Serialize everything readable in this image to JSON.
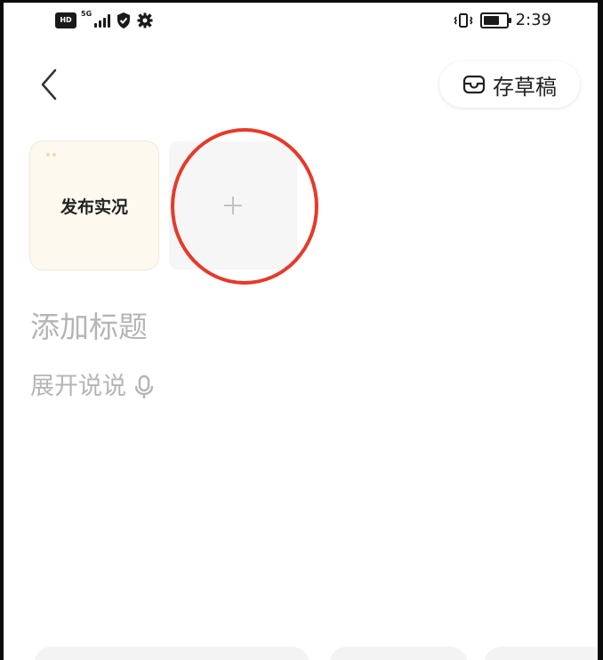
{
  "status_bar": {
    "hd": "HD",
    "network": "5G",
    "time": "2:39"
  },
  "header": {
    "back_icon": "chevron-left-icon",
    "draft_icon": "inbox-tray-icon",
    "draft_label": "存草稿"
  },
  "media": {
    "live_label": "发布实况",
    "add_icon": "plus-icon"
  },
  "editor": {
    "title_placeholder": "添加标题",
    "body_placeholder": "展开说说",
    "mic_icon": "microphone-icon"
  },
  "colors": {
    "annotation_circle": "#e53a2a",
    "live_tile_bg": "#fdf9ef",
    "placeholder_text": "#b5b5b5"
  }
}
